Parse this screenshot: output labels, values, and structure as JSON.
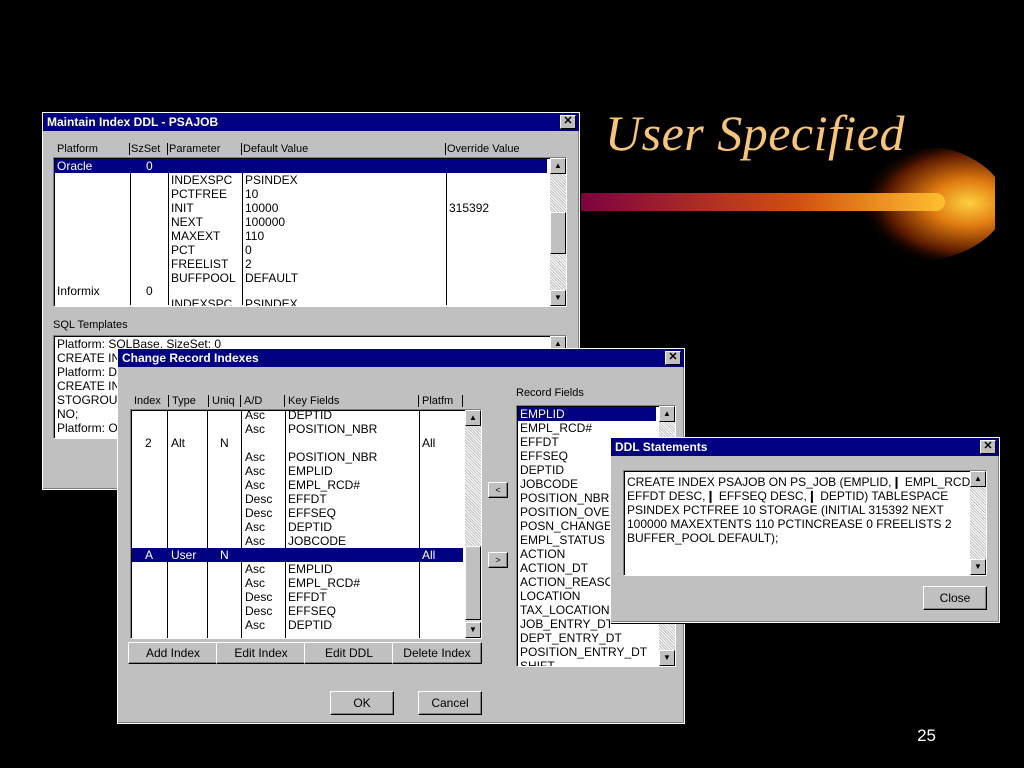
{
  "slide": {
    "title": "User Specified",
    "page_number": "25"
  },
  "maintain": {
    "title": "Maintain Index DDL - PSAJOB",
    "columns": [
      "Platform",
      "SzSet",
      "Parameter",
      "Default Value",
      "Override Value"
    ],
    "selected_platform": "Oracle",
    "selected_szset": "0",
    "rows": [
      {
        "param": "INDEXSPC",
        "def": "PSINDEX",
        "ovr": ""
      },
      {
        "param": "PCTFREE",
        "def": "10",
        "ovr": ""
      },
      {
        "param": "INIT",
        "def": "10000",
        "ovr": "315392"
      },
      {
        "param": "NEXT",
        "def": "100000",
        "ovr": ""
      },
      {
        "param": "MAXEXT",
        "def": "110",
        "ovr": ""
      },
      {
        "param": "PCT",
        "def": "0",
        "ovr": ""
      },
      {
        "param": "FREELIST",
        "def": "2",
        "ovr": ""
      },
      {
        "param": "BUFFPOOL",
        "def": "DEFAULT",
        "ovr": ""
      }
    ],
    "informix_platform": "Informix",
    "informix_szset": "0",
    "informix_param": "INDEXSPC",
    "informix_def": "PSINDEX",
    "sql_templates_label": "SQL Templates",
    "sql_lines": [
      "Platform: SQLBase, SizeSet: 0",
      "CREATE IN",
      "Platform: DB",
      "CREATE IN",
      "STOGROUP",
      "NO;",
      "Platform: Ora"
    ]
  },
  "change": {
    "title": "Change Record Indexes",
    "columns": [
      "Index",
      "Type",
      "Uniq",
      "A/D",
      "Key Fields",
      "Platfm"
    ],
    "rows": [
      {
        "idx": "",
        "type": "",
        "uniq": "",
        "ad": "Asc",
        "key": "DEPTID",
        "plat": ""
      },
      {
        "idx": "",
        "type": "",
        "uniq": "",
        "ad": "Asc",
        "key": "POSITION_NBR",
        "plat": ""
      },
      {
        "idx": "2",
        "type": "Alt",
        "uniq": "N",
        "ad": "",
        "key": "",
        "plat": "All"
      },
      {
        "idx": "",
        "type": "",
        "uniq": "",
        "ad": "Asc",
        "key": "POSITION_NBR",
        "plat": ""
      },
      {
        "idx": "",
        "type": "",
        "uniq": "",
        "ad": "Asc",
        "key": "EMPLID",
        "plat": ""
      },
      {
        "idx": "",
        "type": "",
        "uniq": "",
        "ad": "Asc",
        "key": "EMPL_RCD#",
        "plat": ""
      },
      {
        "idx": "",
        "type": "",
        "uniq": "",
        "ad": "Desc",
        "key": "EFFDT",
        "plat": ""
      },
      {
        "idx": "",
        "type": "",
        "uniq": "",
        "ad": "Desc",
        "key": "EFFSEQ",
        "plat": ""
      },
      {
        "idx": "",
        "type": "",
        "uniq": "",
        "ad": "Asc",
        "key": "DEPTID",
        "plat": ""
      },
      {
        "idx": "",
        "type": "",
        "uniq": "",
        "ad": "Asc",
        "key": "JOBCODE",
        "plat": ""
      },
      {
        "idx": "A",
        "type": "User",
        "uniq": "N",
        "ad": "",
        "key": "",
        "plat": "All",
        "selected": true
      },
      {
        "idx": "",
        "type": "",
        "uniq": "",
        "ad": "Asc",
        "key": "EMPLID",
        "plat": ""
      },
      {
        "idx": "",
        "type": "",
        "uniq": "",
        "ad": "Asc",
        "key": "EMPL_RCD#",
        "plat": ""
      },
      {
        "idx": "",
        "type": "",
        "uniq": "",
        "ad": "Desc",
        "key": "EFFDT",
        "plat": ""
      },
      {
        "idx": "",
        "type": "",
        "uniq": "",
        "ad": "Desc",
        "key": "EFFSEQ",
        "plat": ""
      },
      {
        "idx": "",
        "type": "",
        "uniq": "",
        "ad": "Asc",
        "key": "DEPTID",
        "plat": ""
      }
    ],
    "buttons": {
      "add": "Add Index",
      "edit": "Edit Index",
      "ddl": "Edit DDL",
      "delete": "Delete Index",
      "ok": "OK",
      "cancel": "Cancel"
    },
    "record_fields_label": "Record Fields",
    "record_fields": [
      "EMPLID",
      "EMPL_RCD#",
      "EFFDT",
      "EFFSEQ",
      "DEPTID",
      "JOBCODE",
      "POSITION_NBR",
      "POSITION_OVER",
      "POSN_CHANGE",
      "EMPL_STATUS",
      "ACTION",
      "ACTION_DT",
      "ACTION_REASO",
      "LOCATION",
      "TAX_LOCATION",
      "JOB_ENTRY_DT",
      "DEPT_ENTRY_DT",
      "POSITION_ENTRY_DT",
      "SHIFT"
    ],
    "move_left": "<",
    "move_right": ">"
  },
  "ddl": {
    "title": "DDL Statements",
    "lines": [
      "CREATE INDEX PSAJOB ON PS_JOB (EMPLID,❙   EMPL_RCD#,❙",
      "EFFDT DESC,❙   EFFSEQ DESC,❙   DEPTID) TABLESPACE",
      "PSINDEX  PCTFREE 10 STORAGE (INITIAL 315392 NEXT",
      "100000 MAXEXTENTS 110 PCTINCREASE 0 FREELISTS 2",
      "BUFFER_POOL DEFAULT);"
    ],
    "close": "Close"
  },
  "colors": {
    "titlebar": "#000080",
    "window": "#c0c0c0",
    "title_text": "#f6c47a"
  }
}
